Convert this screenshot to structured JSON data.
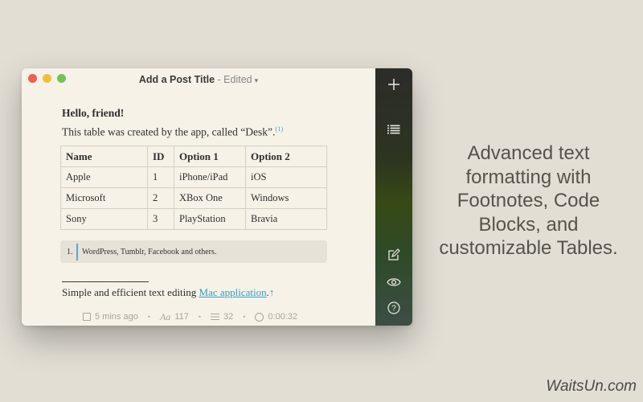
{
  "window": {
    "title": "Add a Post Title",
    "status": " - Edited",
    "caret": "▾"
  },
  "document": {
    "greeting": "Hello, friend!",
    "intro": "This table was created by the app, called “Desk”.",
    "footnote_ref": "(1)",
    "table": {
      "headers": [
        "Name",
        "ID",
        "Option 1",
        "Option 2"
      ],
      "rows": [
        [
          "Apple",
          "1",
          "iPhone/iPad",
          "iOS"
        ],
        [
          "Microsoft",
          "2",
          "XBox One",
          "Windows"
        ],
        [
          "Sony",
          "3",
          "PlayStation",
          "Bravia"
        ]
      ]
    },
    "footnote": {
      "number": "1.",
      "text": "WordPress, Tumblr, Facebook and others."
    },
    "tagline_prefix": "Simple and efficient text editing ",
    "tagline_link": "Mac application",
    "tagline_suffix": ".",
    "tagline_arrow": "↑"
  },
  "statusbar": {
    "time_ago": "5 mins ago",
    "char_icon": "Aa",
    "chars": "117",
    "words": "32",
    "timer": "0:00:32",
    "separator": "•"
  },
  "sidebar": {
    "icons": [
      "plus-icon",
      "list-icon",
      "compose-icon",
      "eye-icon",
      "help-icon"
    ],
    "help_glyph": "?"
  },
  "marketing": {
    "lines": [
      "Advanced text",
      "formatting with",
      "Footnotes, Code",
      "Blocks, and",
      "customizable Tables."
    ]
  },
  "watermark": "WaitsUn.com",
  "colors": {
    "background": "#e2ded4",
    "editor": "#f6f2e8",
    "link": "#3a9bc0",
    "footnote_bar": "#5aa9c4",
    "close": "#ee5e56",
    "minimize": "#f3bd3c",
    "zoom": "#73c457"
  }
}
